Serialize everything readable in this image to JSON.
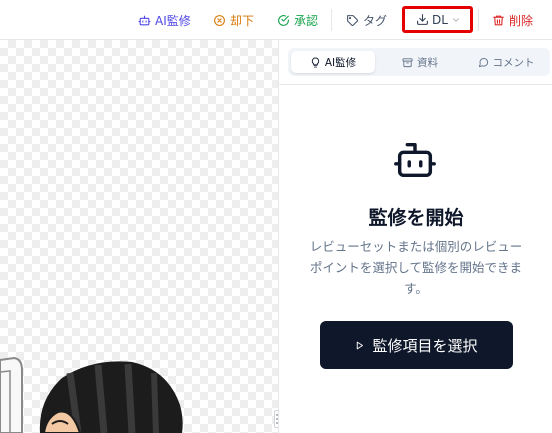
{
  "toolbar": {
    "ai_review": {
      "label": "AI監修",
      "icon": "bot-icon",
      "color": "#4f46e5"
    },
    "reject": {
      "label": "却下",
      "icon": "x-circle-icon",
      "color": "#d97706"
    },
    "approve": {
      "label": "承認",
      "icon": "check-circle-icon",
      "color": "#16a34a"
    },
    "tag": {
      "label": "タグ",
      "icon": "tag-icon",
      "color": "#475569"
    },
    "download": {
      "label": "DL",
      "icon": "download-icon",
      "highlight_color": "#e50000"
    },
    "delete": {
      "label": "削除",
      "icon": "trash-icon",
      "color": "#dc2626"
    }
  },
  "panel": {
    "tabs": [
      {
        "label": "AI監修",
        "icon": "lightbulb-icon",
        "active": true
      },
      {
        "label": "資料",
        "icon": "archive-icon",
        "active": false
      },
      {
        "label": "コメント",
        "icon": "message-circle-icon",
        "active": false
      }
    ],
    "empty_state": {
      "icon": "bot-icon",
      "title": "監修を開始",
      "description": "レビューセットまたは個別のレビューポイントを選択して監修を開始できます。",
      "button_label": "監修項目を選択",
      "button_icon": "play-icon",
      "button_color": "#0f172a"
    }
  }
}
